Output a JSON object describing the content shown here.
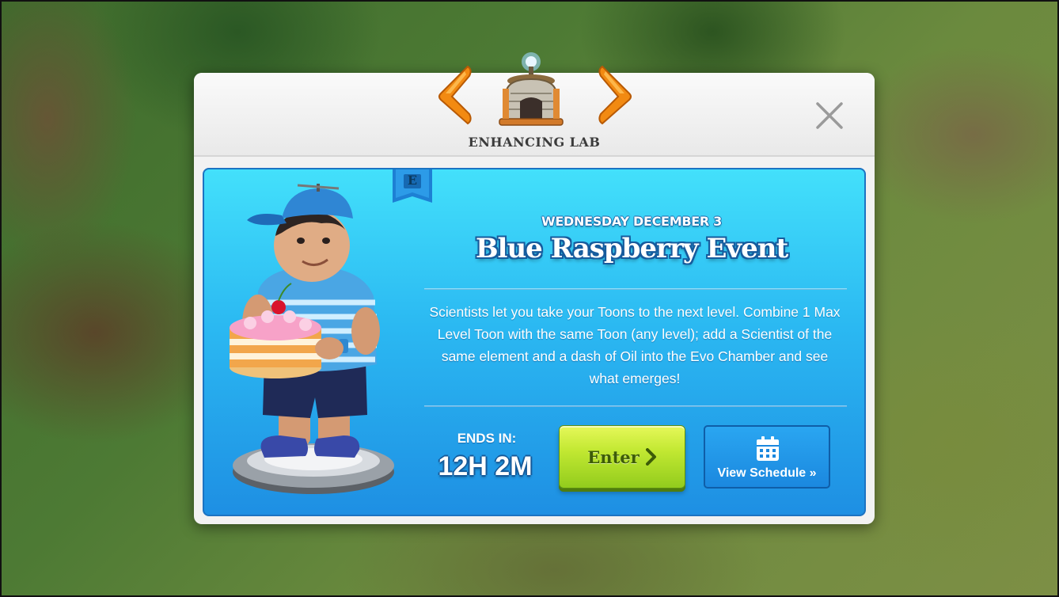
{
  "header": {
    "building_name": "ENHANCING LAB",
    "icons": {
      "prev": "chevron-left-icon",
      "next": "chevron-right-icon",
      "building": "enhancing-lab-icon",
      "close": "close-icon"
    }
  },
  "event": {
    "element_badge": "E",
    "date": "WEDNESDAY DECEMBER 3",
    "title": "Blue Raspberry Event",
    "description": "Scientists let you take your Toons to the next level. Combine 1 Max Level Toon with the same Toon (any level); add a Scientist of the same element and a dash of Oil into the Evo Chamber and see what emerges!",
    "ends_label": "ENDS IN:",
    "ends_value": "12H 2M",
    "enter_label": "Enter",
    "schedule_label": "View Schedule »"
  },
  "colors": {
    "panel_top": "#43e0fb",
    "panel_bottom": "#1e8fe3",
    "enter_button": "#c2e832",
    "schedule_button": "#1b88df",
    "arrow": "#f28a12"
  }
}
